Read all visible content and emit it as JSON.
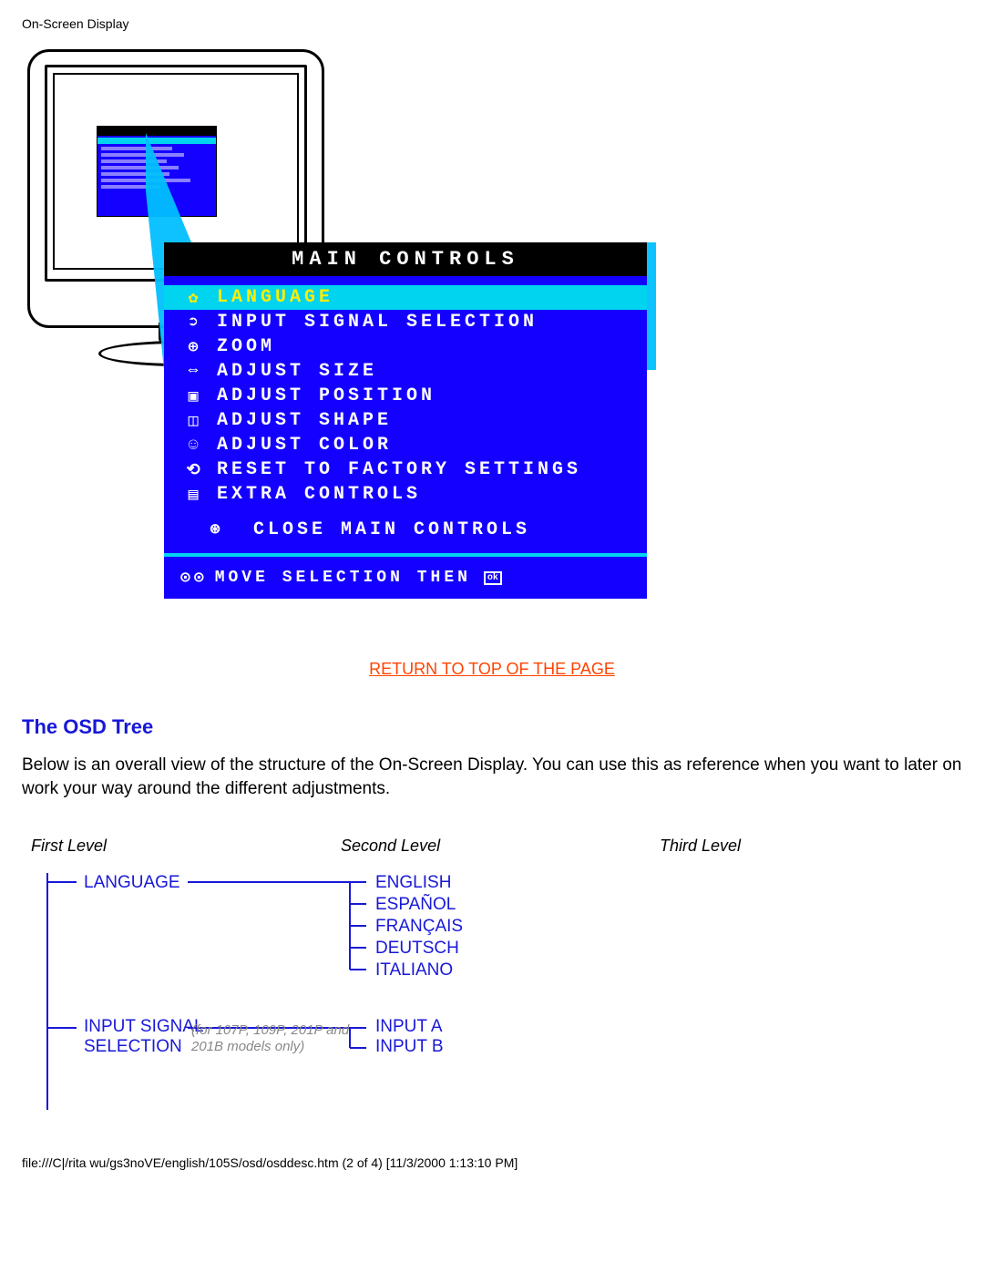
{
  "header": {
    "title": "On-Screen Display"
  },
  "osd": {
    "title": "MAIN CONTROLS",
    "items": [
      {
        "icon": "globe-icon",
        "glyph": "✿",
        "label": "LANGUAGE",
        "selected": true
      },
      {
        "icon": "input-icon",
        "glyph": "➲",
        "label": "INPUT SIGNAL SELECTION",
        "selected": false
      },
      {
        "icon": "zoom-icon",
        "glyph": "⊕",
        "label": "ZOOM",
        "selected": false
      },
      {
        "icon": "size-icon",
        "glyph": "⇔",
        "label": "ADJUST SIZE",
        "selected": false
      },
      {
        "icon": "position-icon",
        "glyph": "▣",
        "label": "ADJUST POSITION",
        "selected": false
      },
      {
        "icon": "shape-icon",
        "glyph": "◫",
        "label": "ADJUST SHAPE",
        "selected": false
      },
      {
        "icon": "color-icon",
        "glyph": "☺",
        "label": "ADJUST COLOR",
        "selected": false
      },
      {
        "icon": "reset-icon",
        "glyph": "⟲",
        "label": "RESET TO FACTORY SETTINGS",
        "selected": false
      },
      {
        "icon": "extra-icon",
        "glyph": "▤",
        "label": "EXTRA CONTROLS",
        "selected": false
      }
    ],
    "close": {
      "glyph": "⊛",
      "label": "CLOSE MAIN CONTROLS"
    },
    "footer": {
      "glyph": "⊙⊙",
      "label": "MOVE SELECTION THEN",
      "ok": "ok"
    }
  },
  "return_link": "RETURN TO TOP OF THE PAGE",
  "section": {
    "title": "The OSD Tree",
    "body": "Below is an overall view of the structure of the On-Screen Display. You can use this as reference when you want to later on work your way around the different adjustments."
  },
  "tree": {
    "headers": {
      "first": "First Level",
      "second": "Second Level",
      "third": "Third Level"
    },
    "language": {
      "label": "LANGUAGE",
      "children": [
        "ENGLISH",
        "ESPAÑOL",
        "FRANÇAIS",
        "DEUTSCH",
        "ITALIANO"
      ]
    },
    "input_signal": {
      "label_line1": "INPUT SIGNAL",
      "label_line2": "SELECTION",
      "note_line1": "(for 107P, 109P, 201P and",
      "note_line2": "201B models only)",
      "children": [
        "INPUT A",
        "INPUT B"
      ]
    }
  },
  "footer_path": "file:///C|/rita wu/gs3noVE/english/105S/osd/osddesc.htm (2 of 4) [11/3/2000 1:13:10 PM]"
}
